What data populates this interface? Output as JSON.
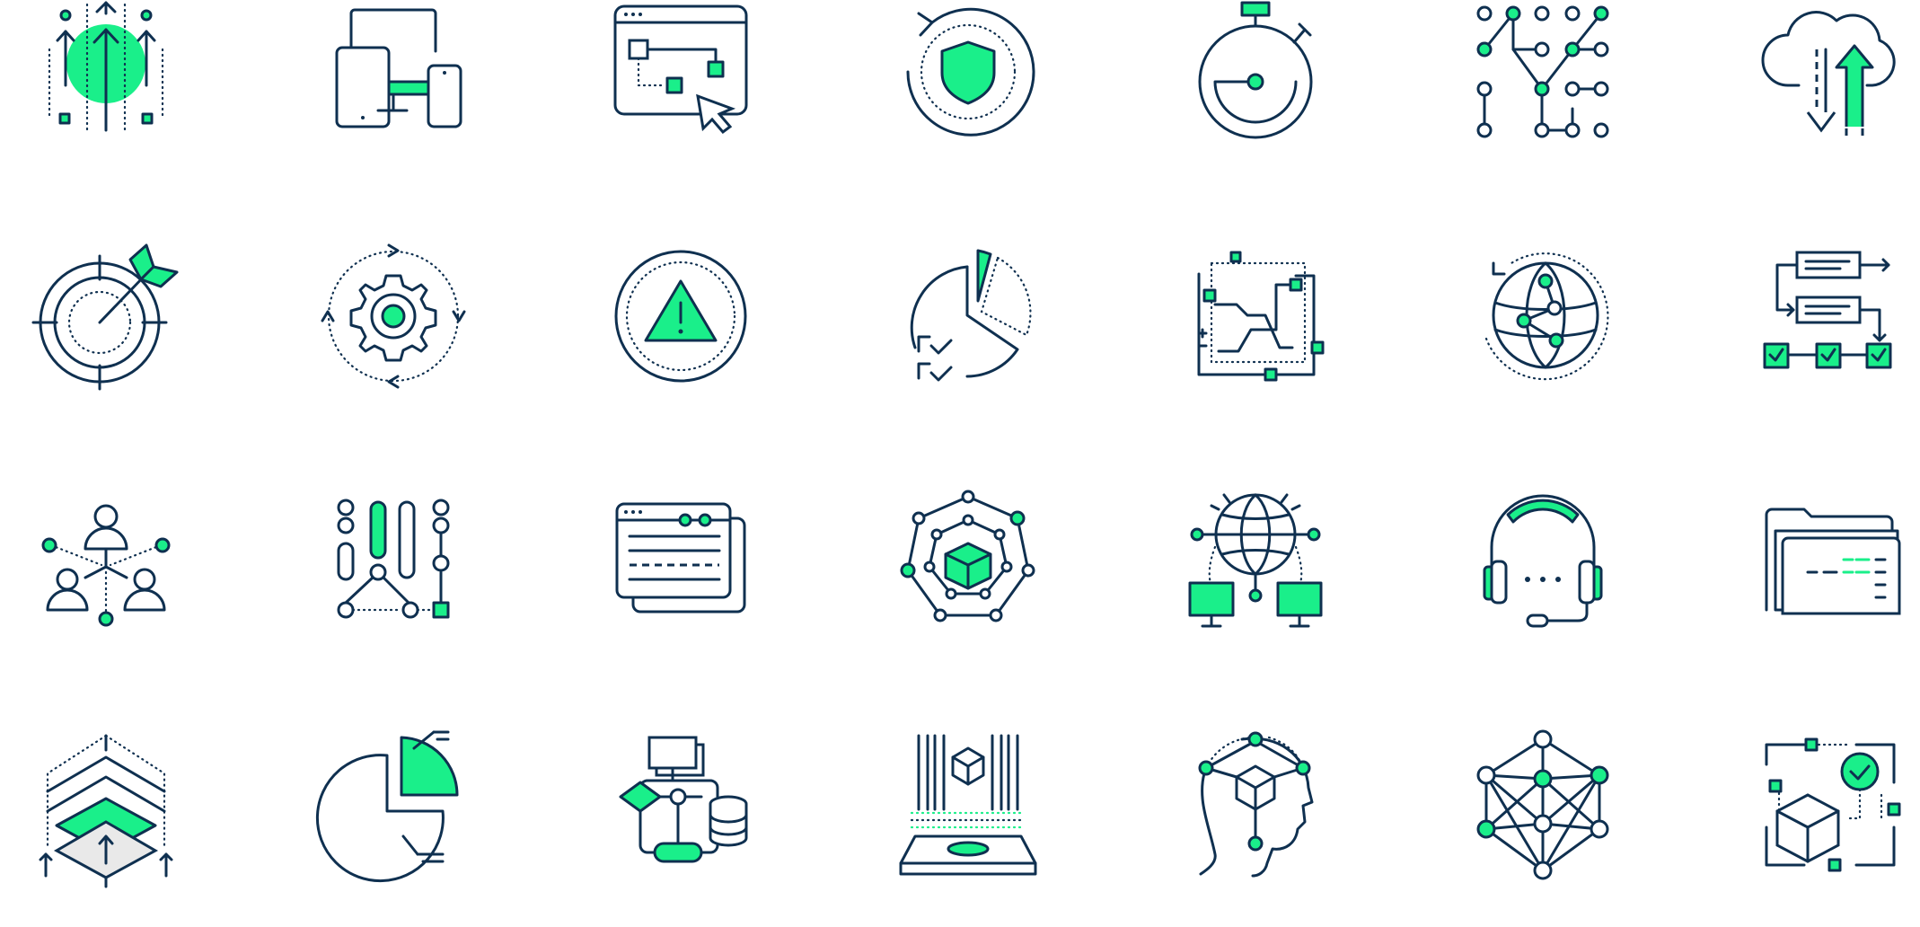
{
  "colors": {
    "stroke": "#0f3050",
    "accent": "#1aef8a",
    "background": "#ffffff"
  },
  "icons": [
    "growth-arrows-icon",
    "multi-device-icon",
    "web-workflow-cursor-icon",
    "shield-refresh-icon",
    "stopwatch-icon",
    "node-pattern-icon",
    "cloud-sync-icon",
    "target-arrow-icon",
    "gear-cycle-icon",
    "warning-alert-icon",
    "pie-checklist-icon",
    "circuit-board-icon",
    "globe-network-icon",
    "process-flow-icon",
    "team-network-icon",
    "slider-controls-icon",
    "browser-windows-icon",
    "cube-network-icon",
    "globe-computers-icon",
    "headset-support-icon",
    "folder-files-icon",
    "layers-stack-icon",
    "pie-chart-icon",
    "database-flowchart-icon",
    "cube-scanner-icon",
    "head-cube-network-icon",
    "neural-network-icon",
    "cube-checkmark-icon"
  ]
}
